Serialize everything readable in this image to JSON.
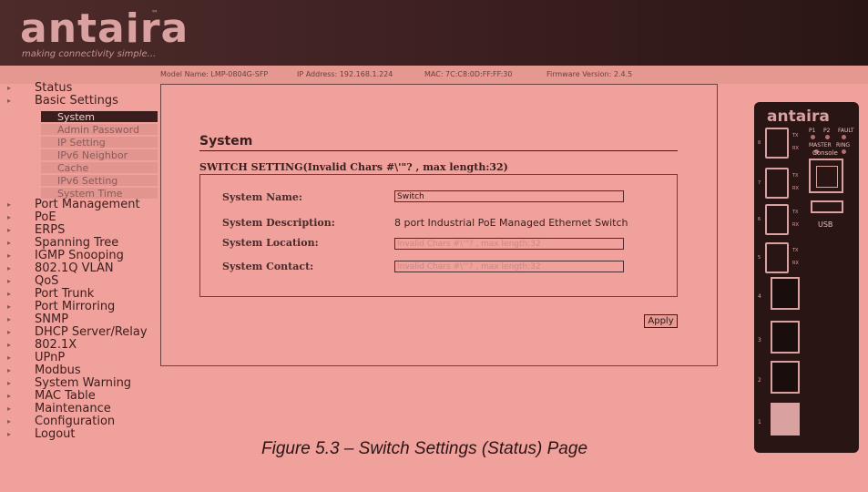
{
  "header": {
    "logo_text": "antaira",
    "logo_tm": "™",
    "tagline": "making connectivity simple..."
  },
  "infobar": {
    "model": "Model Name: LMP-0804G-SFP",
    "ip": "IP Address: 192.168.1.224",
    "mac": "MAC: 7C:C8:0D:FF:FF:30",
    "firmware": "Firmware Version: 2.4.5"
  },
  "sidebar": {
    "top_items": [
      {
        "label": "Status"
      },
      {
        "label": "Basic Settings"
      }
    ],
    "sub_items": [
      {
        "label": "System",
        "active": true
      },
      {
        "label": "Admin Password"
      },
      {
        "label": "IP Setting"
      },
      {
        "label": "IPv6 Neighbor"
      },
      {
        "label": "Cache"
      },
      {
        "label": "IPv6 Setting"
      },
      {
        "label": "System Time"
      }
    ],
    "items": [
      {
        "label": "Port Management"
      },
      {
        "label": "PoE"
      },
      {
        "label": "ERPS"
      },
      {
        "label": "Spanning Tree"
      },
      {
        "label": "IGMP Snooping"
      },
      {
        "label": "802.1Q VLAN"
      },
      {
        "label": "QoS"
      },
      {
        "label": "Port Trunk"
      },
      {
        "label": "Port Mirroring"
      },
      {
        "label": "SNMP"
      },
      {
        "label": "DHCP Server/Relay"
      },
      {
        "label": "802.1X"
      },
      {
        "label": "UPnP"
      },
      {
        "label": "Modbus"
      },
      {
        "label": "System Warning"
      },
      {
        "label": "MAC Table"
      },
      {
        "label": "Maintenance"
      },
      {
        "label": "Configuration"
      },
      {
        "label": "Logout"
      }
    ]
  },
  "main": {
    "title": "System",
    "section_title": "SWITCH SETTING(Invalid Chars #\\'\"? , max length:32)",
    "fields": {
      "name_label": "System Name:",
      "name_value": "Switch",
      "description_label": "System Description:",
      "description_value": "8 port Industrial PoE Managed Ethernet Switch",
      "location_label": "System Location:",
      "location_placeholder": "Invalid Chars  #\\'\"? , max length:32",
      "contact_label": "System Contact:",
      "contact_placeholder": "Invalid Chars  #\\'\"? , max length:32"
    },
    "apply_label": "Apply"
  },
  "caption": "Figure 5.3 – Switch Settings (Status) Page",
  "device": {
    "logo": "antaira",
    "leds": [
      "P1",
      "P2",
      "FAULT",
      "MASTER",
      "RING"
    ],
    "console_label": "Console",
    "usb_label": "USB",
    "sfp_ports": [
      "8",
      "7",
      "6",
      "5"
    ],
    "rj45_ports": [
      "4",
      "3",
      "2",
      "1"
    ],
    "tx_label": "TX",
    "rx_label": "RX"
  }
}
